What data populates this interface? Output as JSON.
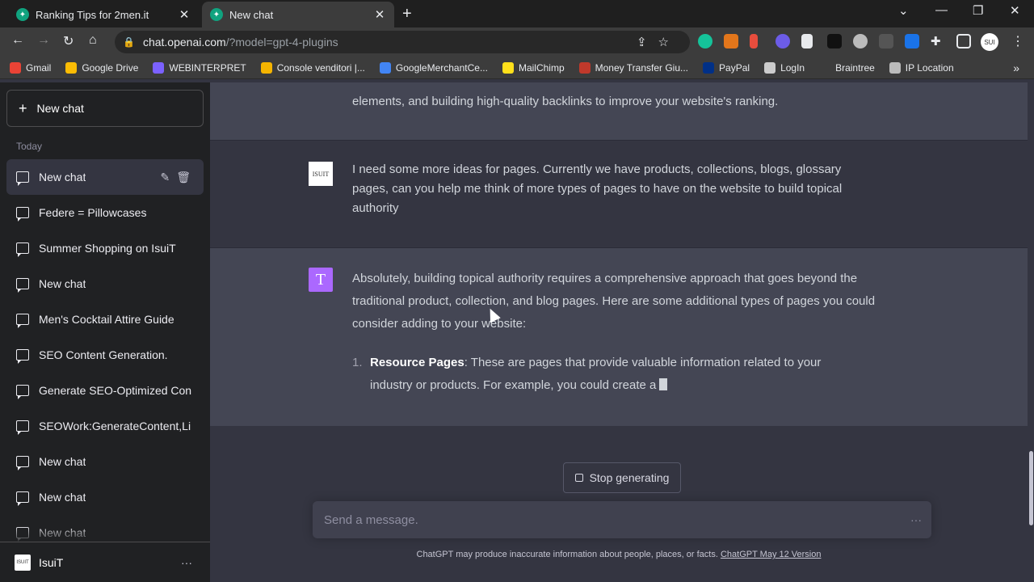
{
  "browser": {
    "tabs": [
      {
        "title": "Ranking Tips for 2men.it"
      },
      {
        "title": "New chat"
      }
    ],
    "url_host": "chat.openai.com",
    "url_path": "/?model=gpt-4-plugins",
    "bookmarks": [
      "Gmail",
      "Google Drive",
      "WEBINTERPRET",
      "Console venditori |...",
      "GoogleMerchantCe...",
      "MailChimp",
      "Money Transfer Giu...",
      "PayPal",
      "LogIn",
      "Braintree",
      "IP Location"
    ],
    "bookmark_colors": [
      "#ea4335",
      "#fbbc04",
      "#7b61ff",
      "#f4b400",
      "#4285f4",
      "#ffe01b",
      "#c0392b",
      "#003087",
      "#cccccc",
      "#3c3c3c",
      "#bbbbbb"
    ]
  },
  "sidebar": {
    "new_chat_label": "New chat",
    "section_label": "Today",
    "chats": [
      {
        "label": "New chat"
      },
      {
        "label": "Federe = Pillowcases"
      },
      {
        "label": "Summer Shopping on IsuiT"
      },
      {
        "label": "New chat"
      },
      {
        "label": "Men's Cocktail Attire Guide"
      },
      {
        "label": "SEO Content Generation."
      },
      {
        "label": "Generate SEO-Optimized Con"
      },
      {
        "label": "SEOWork:GenerateContent,Li"
      },
      {
        "label": "New chat"
      },
      {
        "label": "New chat"
      },
      {
        "label": "New chat"
      }
    ],
    "user_name": "IsuiT",
    "user_avatar_text": "ISUIT"
  },
  "conversation": {
    "prev_ai_tail": "elements, and building high-quality backlinks to improve your website's ranking.",
    "user_message": "I need some more ideas for pages. Currently we have products, collections, blogs, glossary pages, can you help me think of more types of pages to have on the website to build topical authority",
    "ai_avatar_letter": "T",
    "ai_intro": "Absolutely, building topical authority requires a comprehensive approach that goes beyond the traditional product, collection, and blog pages. Here are some additional types of pages you could consider adding to your website:",
    "ai_list": [
      {
        "num": "1.",
        "title": "Resource Pages",
        "text": ": These are pages that provide valuable information related to your industry or products. For example, you could create a"
      }
    ]
  },
  "composer": {
    "stop_label": "Stop generating",
    "placeholder": "Send a message.",
    "disclaimer": "ChatGPT may produce inaccurate information about people, places, or facts. ",
    "version_link": "ChatGPT May 12 Version"
  }
}
